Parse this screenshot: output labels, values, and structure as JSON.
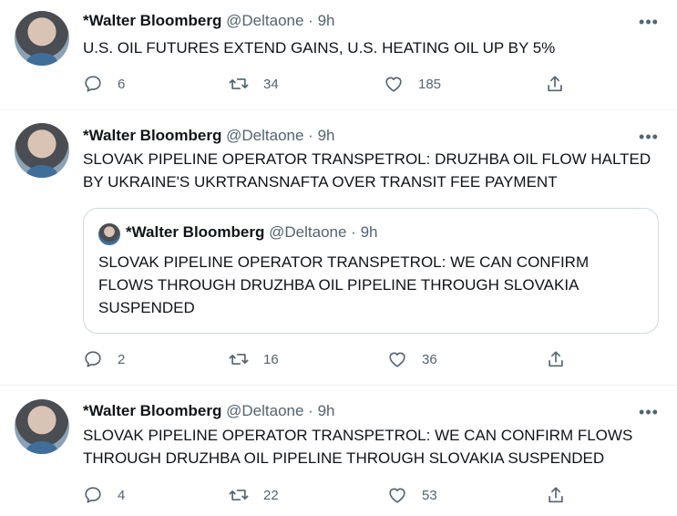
{
  "tweets": [
    {
      "author": {
        "name": "*Walter Bloomberg",
        "handle": "@Deltaone",
        "time": "9h"
      },
      "text": "U.S. OIL FUTURES EXTEND GAINS, U.S. HEATING OIL UP BY 5%",
      "stats": {
        "replies": "6",
        "retweets": "34",
        "likes": "185"
      }
    },
    {
      "author": {
        "name": "*Walter Bloomberg",
        "handle": "@Deltaone",
        "time": "9h"
      },
      "text": "SLOVAK PIPELINE OPERATOR TRANSPETROL: DRUZHBA OIL FLOW HALTED BY UKRAINE'S UKRTRANSNAFTA OVER TRANSIT FEE PAYMENT",
      "quoted": {
        "author": {
          "name": "*Walter Bloomberg",
          "handle": "@Deltaone",
          "time": "9h"
        },
        "text": "SLOVAK PIPELINE OPERATOR TRANSPETROL: WE CAN CONFIRM FLOWS THROUGH DRUZHBA OIL PIPELINE THROUGH SLOVAKIA SUSPENDED"
      },
      "stats": {
        "replies": "2",
        "retweets": "16",
        "likes": "36"
      }
    },
    {
      "author": {
        "name": "*Walter Bloomberg",
        "handle": "@Deltaone",
        "time": "9h"
      },
      "text": "SLOVAK PIPELINE OPERATOR TRANSPETROL: WE CAN CONFIRM FLOWS THROUGH DRUZHBA OIL PIPELINE THROUGH SLOVAKIA SUSPENDED",
      "stats": {
        "replies": "4",
        "retweets": "22",
        "likes": "53"
      }
    }
  ],
  "ui": {
    "separator": "·",
    "more_glyph": "•••"
  },
  "icons": {
    "reply": "reply-icon",
    "retweet": "retweet-icon",
    "like": "heart-icon",
    "share": "share-icon"
  },
  "colors": {
    "text": "#0f1419",
    "secondary": "#536471",
    "border": "#cfd9de"
  }
}
